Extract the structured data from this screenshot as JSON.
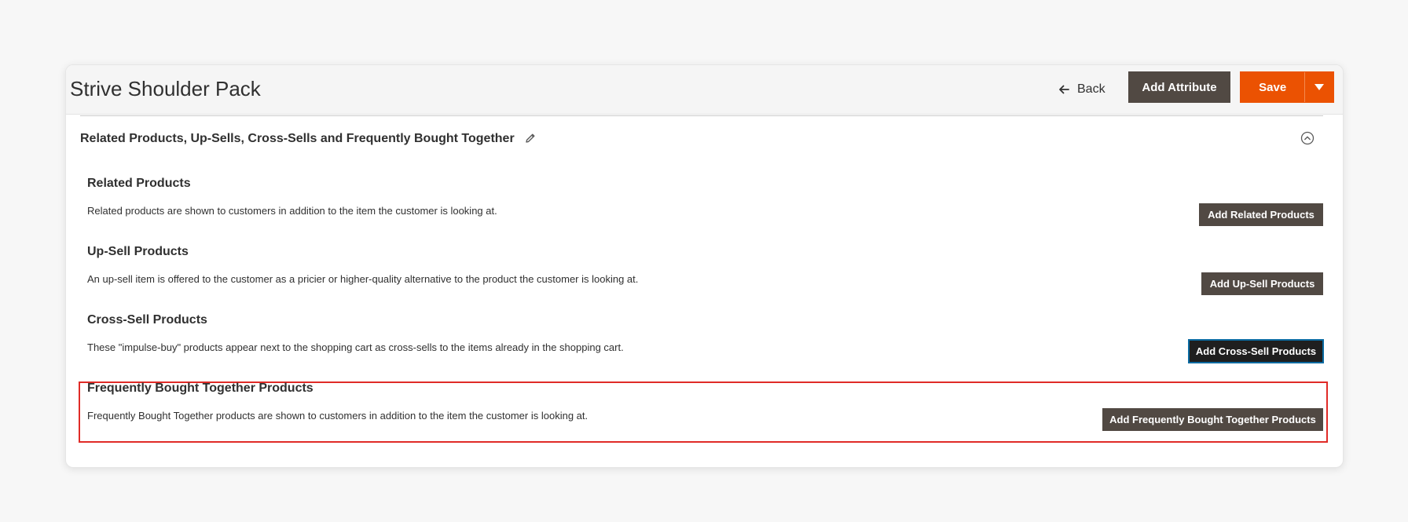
{
  "header": {
    "title": "Strive Shoulder Pack",
    "back_label": "Back",
    "add_attribute_label": "Add Attribute",
    "save_label": "Save"
  },
  "section": {
    "title": "Related Products, Up-Sells, Cross-Sells and Frequently Bought Together"
  },
  "blocks": [
    {
      "title": "Related Products",
      "description": "Related products are shown to customers in addition to the item the customer is looking at.",
      "button": "Add Related Products"
    },
    {
      "title": "Up-Sell Products",
      "description": "An up-sell item is offered to the customer as a pricier or higher-quality alternative to the product the customer is looking at.",
      "button": "Add Up-Sell Products"
    },
    {
      "title": "Cross-Sell Products",
      "description": "These \"impulse-buy\" products appear next to the shopping cart as cross-sells to the items already in the shopping cart.",
      "button": "Add Cross-Sell Products"
    },
    {
      "title": "Frequently Bought Together Products",
      "description": "Frequently Bought Together products are shown to customers in addition to the item the customer is looking at.",
      "button": "Add Frequently Bought Together Products"
    }
  ],
  "colors": {
    "brand_orange": "#eb5202",
    "dark_button": "#514943",
    "highlight_red": "#e02b27"
  },
  "icons": {
    "back": "arrow-left-icon",
    "save_toggle": "caret-down-icon",
    "edit": "pencil-icon",
    "collapse": "chevron-up-circle-icon"
  }
}
